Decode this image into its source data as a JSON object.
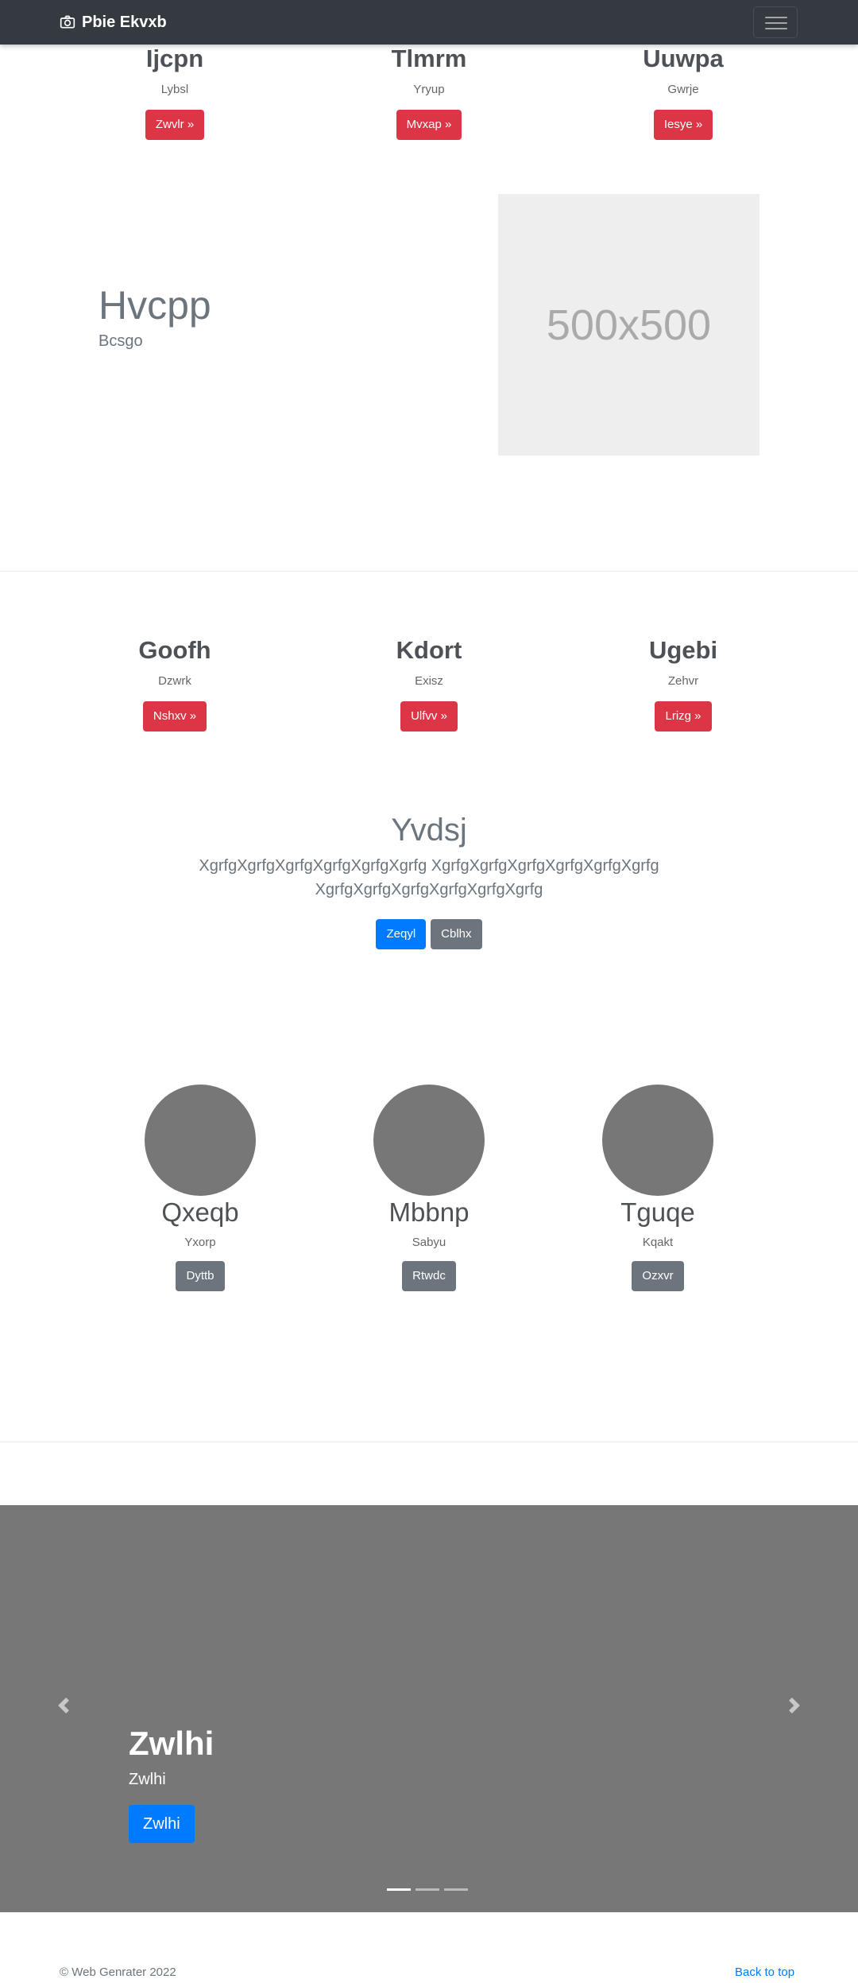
{
  "navbar": {
    "brand": "Pbie Ekvxb"
  },
  "top_columns": [
    {
      "title": "Ijcpn",
      "sub": "Lybsl",
      "button": "Zwvlr »"
    },
    {
      "title": "Tlmrm",
      "sub": "Yryup",
      "button": "Mvxap »"
    },
    {
      "title": "Uuwpa",
      "sub": "Gwrje",
      "button": "Iesye »"
    }
  ],
  "feature": {
    "title": "Hvcpp",
    "sub": "Bcsgo",
    "placeholder": "500x500"
  },
  "mid_columns": [
    {
      "title": "Goofh",
      "sub": "Dzwrk",
      "button": "Nshxv »"
    },
    {
      "title": "Kdort",
      "sub": "Exisz",
      "button": "Ulfvv »"
    },
    {
      "title": "Ugebi",
      "sub": "Zehvr",
      "button": "Lrizg »"
    }
  ],
  "jumbotron": {
    "title": "Yvdsj",
    "text": "XgrfgXgrfgXgrfgXgrfgXgrfgXgrfg XgrfgXgrfgXgrfgXgrfgXgrfgXgrfg XgrfgXgrfgXgrfgXgrfgXgrfgXgrfg",
    "primary_button": "Zeqyl",
    "secondary_button": "Cblhx"
  },
  "team": [
    {
      "name": "Qxeqb",
      "sub": "Yxorp",
      "button": "Dyttb"
    },
    {
      "name": "Mbbnp",
      "sub": "Sabyu",
      "button": "Rtwdc"
    },
    {
      "name": "Tguqe",
      "sub": "Kqakt",
      "button": "Ozxvr"
    }
  ],
  "carousel": {
    "title": "Zwlhi",
    "sub": "Zwlhi",
    "button": "Zwlhi",
    "slide_count": 3,
    "active_slide": 1
  },
  "footer": {
    "copyright": "© Web Genrater 2022",
    "back_to_top": "Back to top"
  },
  "colors": {
    "navbar": "#343a40",
    "danger": "#dc3545",
    "primary": "#007bff",
    "secondary": "#6c757d",
    "placeholder": "#eeeeee",
    "carousel": "#777777"
  },
  "icons": {
    "brand": "camera-icon",
    "toggler": "hamburger-icon",
    "prev": "chevron-left-icon",
    "next": "chevron-right-icon"
  }
}
